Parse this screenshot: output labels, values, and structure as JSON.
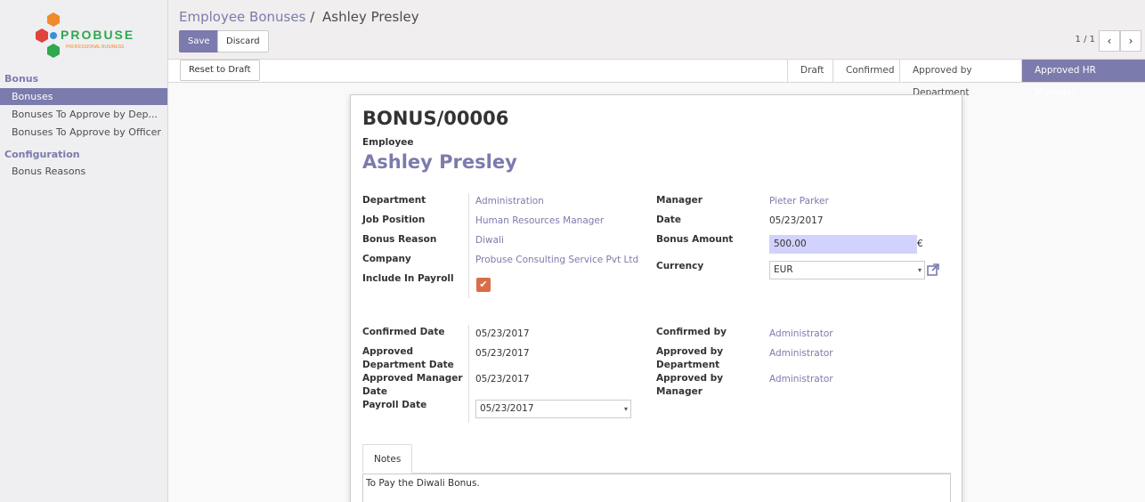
{
  "brand": {
    "name": "PROBUSE",
    "tagline": "PROFESSIONAL BUSINESS"
  },
  "sidebar": {
    "sections": [
      {
        "title": "Bonus",
        "items": [
          "Bonuses",
          "Bonuses To Approve by Dep...",
          "Bonuses To Approve by Officer"
        ]
      },
      {
        "title": "Configuration",
        "items": [
          "Bonus Reasons"
        ]
      }
    ]
  },
  "header": {
    "breadcrumb_parent": "Employee Bonuses",
    "breadcrumb_sep": "/",
    "breadcrumb_current": "Ashley Presley",
    "save_label": "Save",
    "discard_label": "Discard",
    "pager": "1 / 1",
    "prev_icon": "‹",
    "next_icon": "›"
  },
  "statusbar": {
    "reset_label": "Reset to Draft",
    "steps": [
      "Draft",
      "Confirmed",
      "Approved by Department",
      "Approved HR Manager"
    ],
    "active_step": "Approved HR Manager"
  },
  "form": {
    "name": "BONUS/00006",
    "employee_label": "Employee",
    "employee": "Ashley Presley",
    "left": {
      "department_label": "Department",
      "department": "Administration",
      "job_label": "Job Position",
      "job": "Human Resources Manager",
      "reason_label": "Bonus Reason",
      "reason": "Diwali",
      "company_label": "Company",
      "company": "Probuse Consulting Service Pvt Ltd",
      "payroll_label": "Include In Payroll",
      "payroll_checked": true
    },
    "right": {
      "manager_label": "Manager",
      "manager": "Pieter Parker",
      "date_label": "Date",
      "date": "05/23/2017",
      "amount_label": "Bonus Amount",
      "amount": "500.00",
      "currency_symbol": "€",
      "currency_label": "Currency",
      "currency": "EUR"
    },
    "dates": {
      "confirmed_date_label": "Confirmed Date",
      "confirmed_date": "05/23/2017",
      "approved_dept_date_label_1": "Approved",
      "approved_dept_date_label_2": "Department Date",
      "approved_dept_date": "05/23/2017",
      "approved_mgr_date_label_1": "Approved Manager",
      "approved_mgr_date_label_2": "Date",
      "approved_mgr_date": "05/23/2017",
      "payroll_date_label": "Payroll Date",
      "payroll_date": "05/23/2017"
    },
    "approvals": {
      "confirmed_by_label": "Confirmed by",
      "confirmed_by": "Administrator",
      "approved_dept_label_1": "Approved by",
      "approved_dept_label_2": "Department",
      "approved_dept": "Administrator",
      "approved_mgr_label_1": "Approved by",
      "approved_mgr_label_2": "Manager",
      "approved_mgr": "Administrator"
    },
    "notes_tab": "Notes",
    "notes": "To Pay the Diwali Bonus."
  },
  "colors": {
    "accent": "#7c7bad",
    "checkbox": "#d86e48",
    "highlight": "#d2d2ff"
  }
}
